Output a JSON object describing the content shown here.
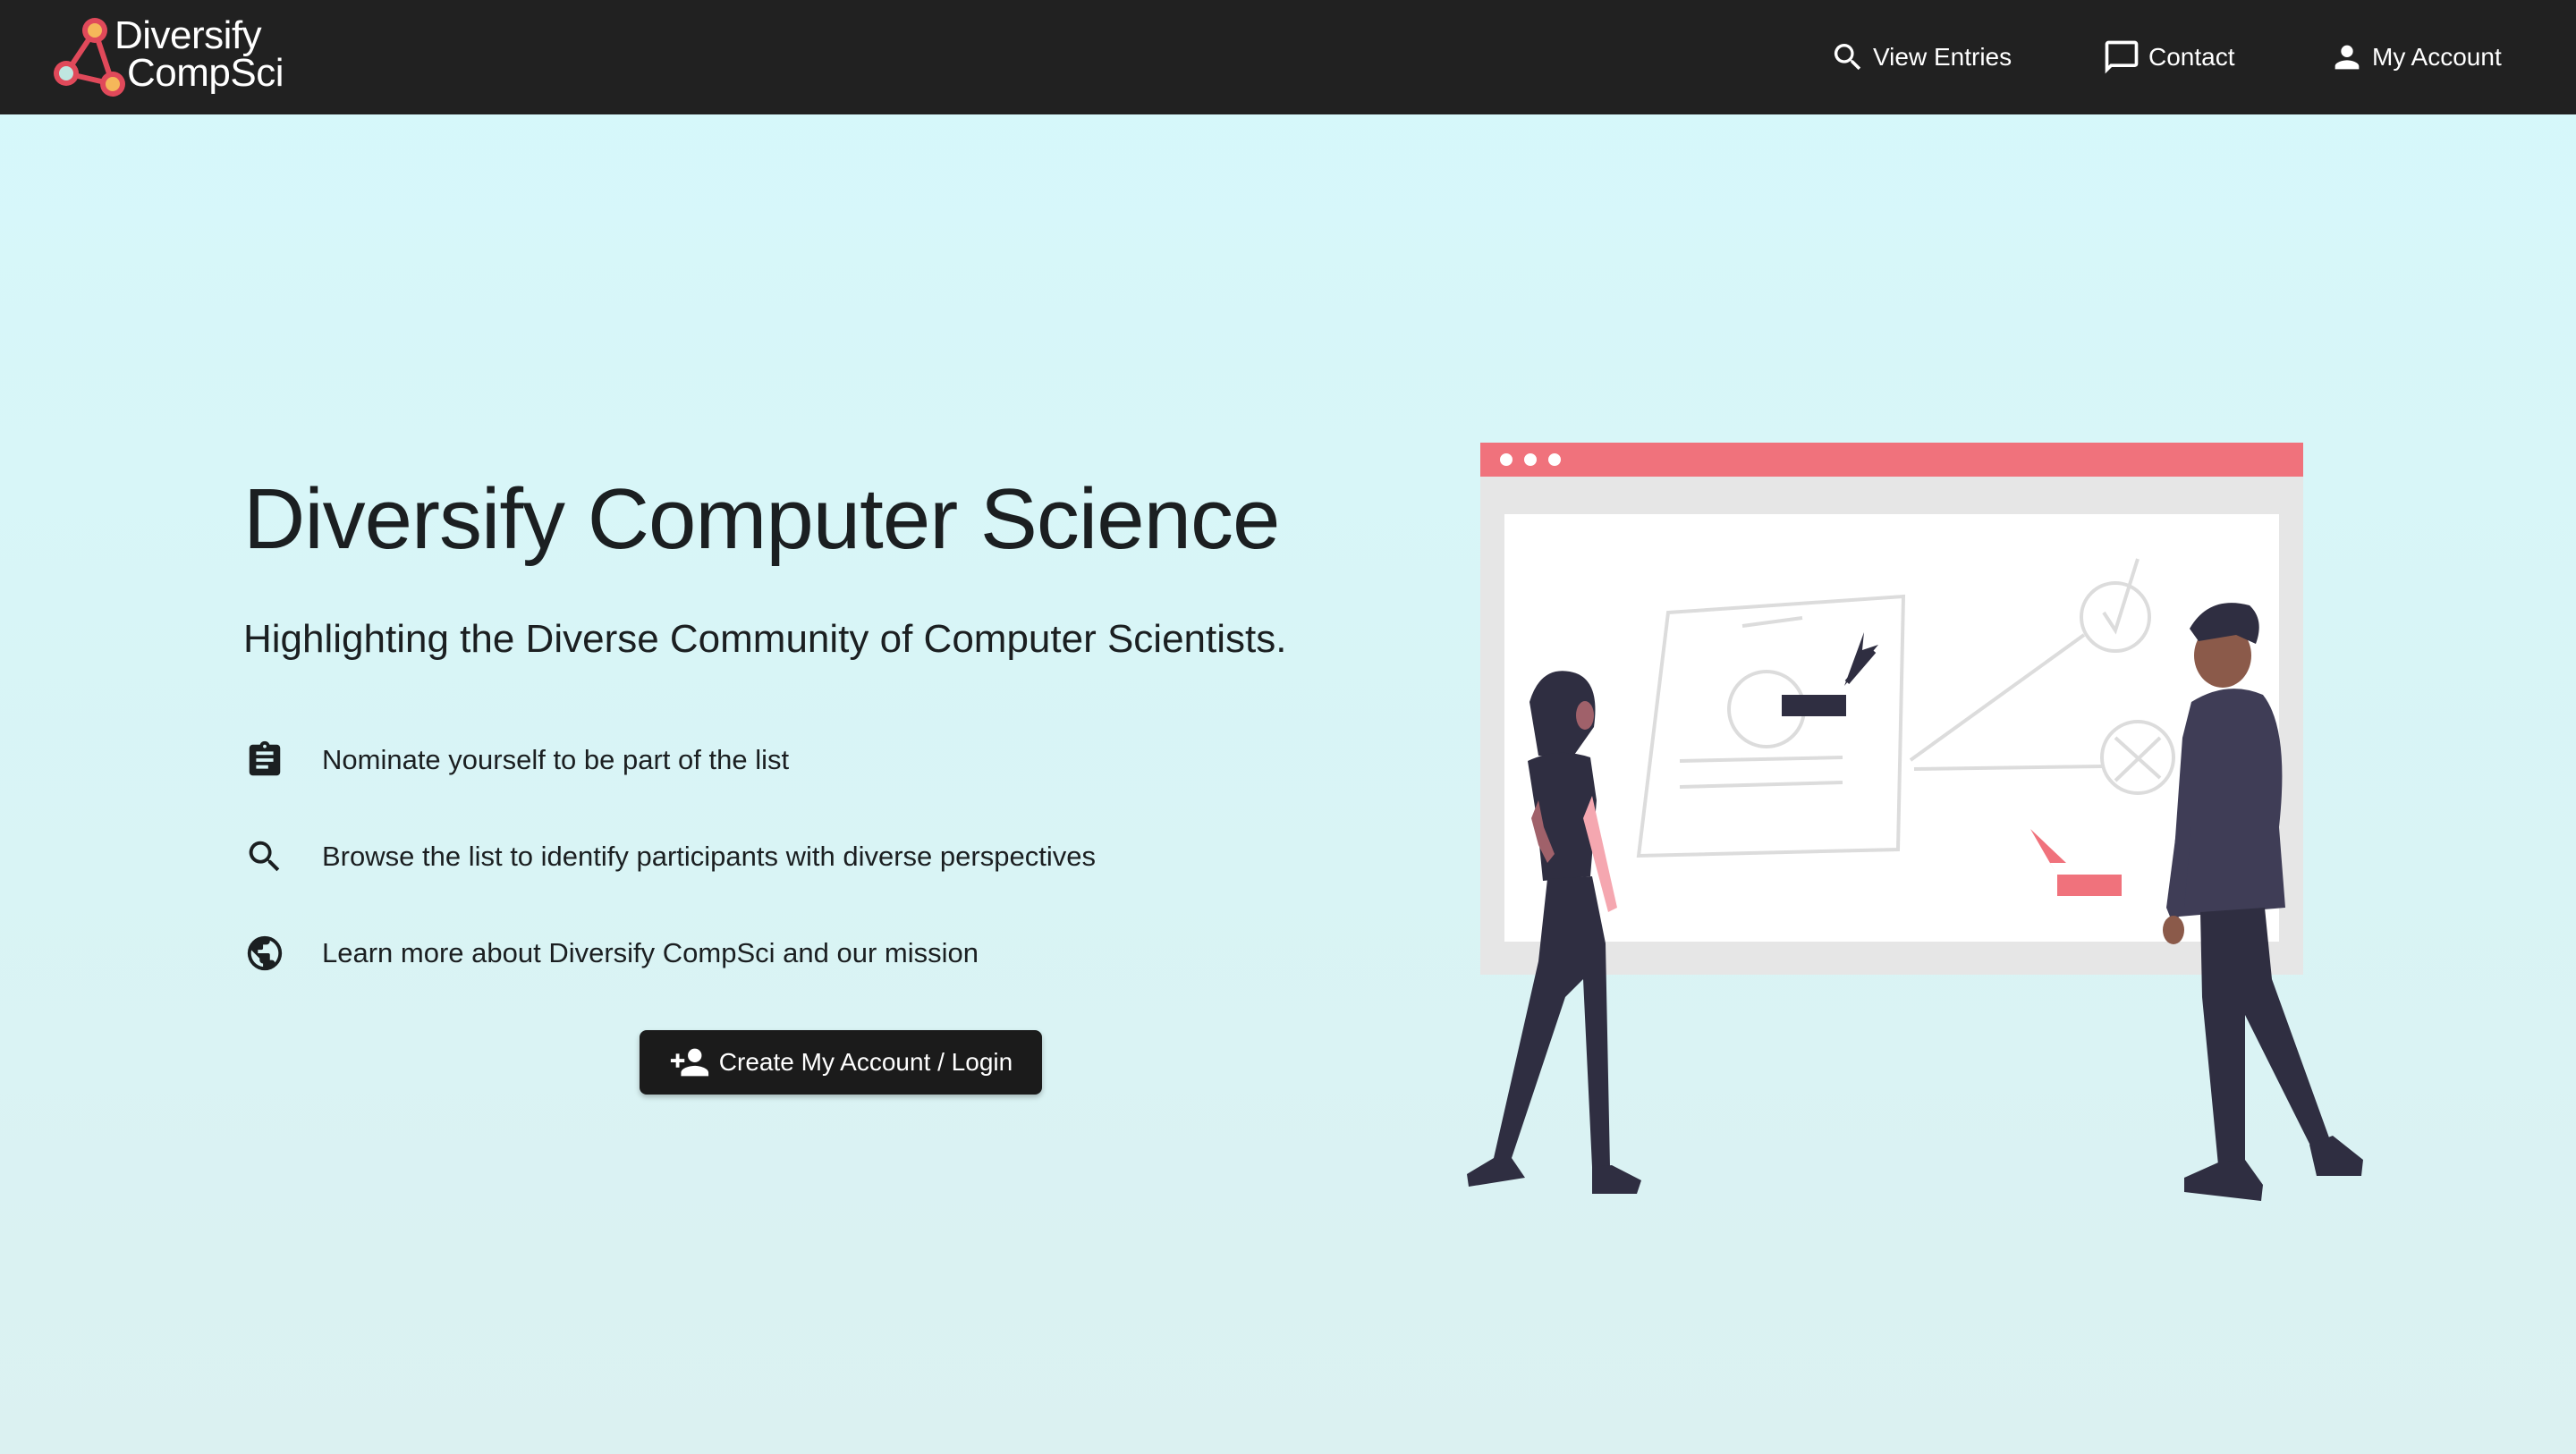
{
  "header": {
    "logo_line1": "Diversify",
    "logo_line2": "CompSci",
    "nav": {
      "view_entries": "View Entries",
      "contact": "Contact",
      "my_account": "My Account"
    }
  },
  "hero": {
    "title": "Diversify Computer Science",
    "subtitle": "Highlighting the Diverse Community of Computer Scientists.",
    "features": [
      {
        "icon": "clipboard-icon",
        "text": "Nominate yourself to be part of the list"
      },
      {
        "icon": "search-icon",
        "text": "Browse the list to identify participants with diverse perspectives"
      },
      {
        "icon": "globe-icon",
        "text": "Learn more about Diversify CompSci and our mission"
      }
    ],
    "cta_label": "Create My Account / Login"
  },
  "colors": {
    "header_bg": "#212121",
    "accent": "#f0727c",
    "text_dark": "#1b1f21",
    "figure_dark": "#2f2e41"
  }
}
